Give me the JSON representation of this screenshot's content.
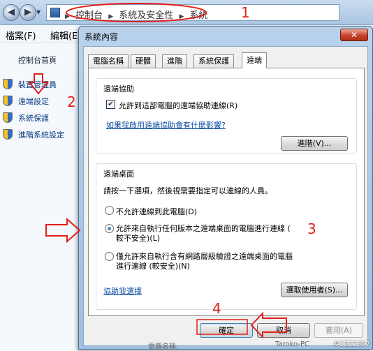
{
  "explorer": {
    "address_crumbs": [
      "控制台",
      "系統及安全性",
      "系統"
    ],
    "menu": [
      "檔案(F)",
      "編輯(E)"
    ],
    "left_pane": {
      "home": "控制台首頁",
      "tasks": [
        "裝置管理員",
        "遠端設定",
        "系統保護",
        "進階系統設定"
      ]
    }
  },
  "dialog": {
    "title": "系統內容",
    "close_label": "✕",
    "tabs": [
      "電腦名稱",
      "硬體",
      "進階",
      "系統保護",
      "遠端"
    ],
    "active_tab": "遠端",
    "remote_assistance": {
      "group_label": "遠端協助",
      "checkbox_label": "允許到這部電腦的遠端協助連線(R)",
      "checkbox_checked": true,
      "help_link": "如果我啟用遠端協助會有什麼影響?",
      "advanced_button": "進階(V)..."
    },
    "remote_desktop": {
      "group_label": "遠端桌面",
      "instruction": "請按一下選項，然後視需要指定可以連線的人員。",
      "options": [
        {
          "label": "不允許連線到此電腦(D)",
          "selected": false
        },
        {
          "label_line1": "允許來自執行任何版本之遠端桌面的電腦進行連線 (",
          "label_line2": "較不安全)(L)",
          "selected": true
        },
        {
          "label_line1": "僅允許來自執行含有網路層級驗證之遠端桌面的電腦",
          "label_line2": "進行連線 (較安全)(N)",
          "selected": false
        }
      ],
      "help_link": "協助我選擇",
      "select_users_button": "選取使用者(S)..."
    },
    "buttons": {
      "ok": "確定",
      "cancel": "取消",
      "apply": "套用(A)"
    }
  },
  "annotations": [
    "1",
    "2",
    "3",
    "4"
  ],
  "status_partial": {
    "label": "電腦名稱:",
    "value": "Taroko-PC"
  },
  "watermark": "#1522357",
  "colors": {
    "annotation": "#e0201a",
    "link": "#0c4da2",
    "titlebar": "#b9d2ec"
  }
}
